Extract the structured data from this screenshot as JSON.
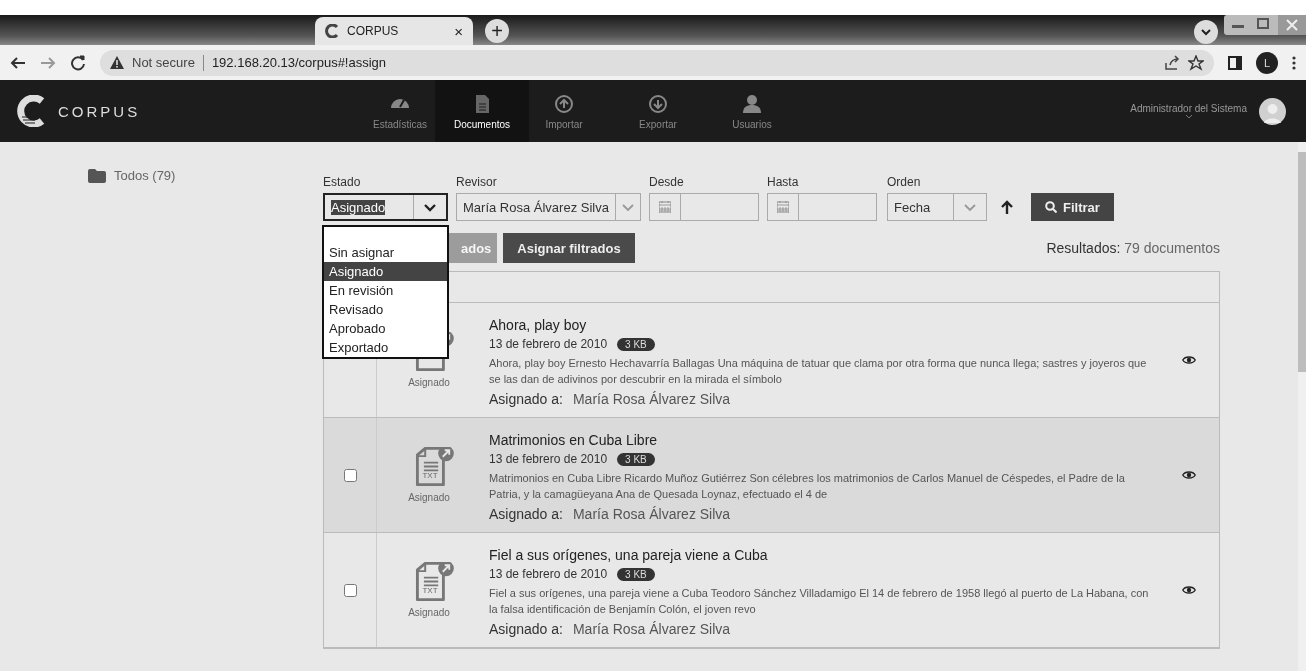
{
  "browser": {
    "tab_title": "CORPUS",
    "tab_close": "×",
    "new_tab": "+",
    "security": "Not secure",
    "url": "192.168.20.13/corpus#!assign",
    "profile": "L"
  },
  "navbar": {
    "logo": "CORPUS",
    "items": [
      {
        "label": "Estadísticas",
        "selected": false
      },
      {
        "label": "Documentos",
        "selected": true
      },
      {
        "label": "Importar",
        "selected": false
      },
      {
        "label": "Exportar",
        "selected": false
      },
      {
        "label": "Usuarios",
        "selected": false
      }
    ],
    "user": "Administrador del Sistema"
  },
  "sidebar": {
    "folders": [
      {
        "label": "Todos (79)"
      }
    ]
  },
  "filters": {
    "estado": {
      "label": "Estado",
      "value": "Asignado",
      "options": [
        {
          "label": "Sin asignar",
          "selected": false
        },
        {
          "label": "Asignado",
          "selected": true
        },
        {
          "label": "En revisión",
          "selected": false
        },
        {
          "label": "Revisado",
          "selected": false
        },
        {
          "label": "Aprobado",
          "selected": false
        },
        {
          "label": "Exportado",
          "selected": false
        }
      ]
    },
    "revisor": {
      "label": "Revisor",
      "value": "María Rosa Álvarez Silva"
    },
    "desde": {
      "label": "Desde"
    },
    "hasta": {
      "label": "Hasta"
    },
    "orden": {
      "label": "Orden",
      "value": "Fecha"
    },
    "filter_button": "Filtrar"
  },
  "actions": [
    {
      "label": "ados",
      "disabled": true
    },
    {
      "label": "Asignar filtrados",
      "disabled": false
    }
  ],
  "results": {
    "label": "Resultados:",
    "count": "79 documentos"
  },
  "documents": [
    {
      "title": "Ahora, play boy",
      "date": "13 de febrero de 2010",
      "size": "3 KB",
      "excerpt": "Ahora, play boy Ernesto Hechavarría Ballagas Una máquina de tatuar que clama por otra forma que nunca llega; sastres y joyeros que se las dan de adivinos por descubrir en la mirada el símbolo",
      "status": "Asignado",
      "assigned_label": "Asignado a:",
      "assignee": "María Rosa Álvarez Silva",
      "highlighted": false
    },
    {
      "title": "Matrimonios en Cuba Libre",
      "file_type": "TXT",
      "date": "13 de febrero de 2010",
      "size": "3 KB",
      "excerpt": "Matrimonios en Cuba Libre Ricardo Muñoz Gutiérrez Son célebres los matrimonios de Carlos Manuel de Céspedes, el Padre de la Patria, y la camagüeyana Ana de Quesada Loynaz, efectuado el 4 de",
      "status": "Asignado",
      "assigned_label": "Asignado a:",
      "assignee": "María Rosa Álvarez Silva",
      "highlighted": true,
      "checked": false
    },
    {
      "title": "Fiel a sus orígenes, una pareja viene a Cuba",
      "file_type": "TXT",
      "date": "13 de febrero de 2010",
      "size": "3 KB",
      "excerpt": "Fiel a sus orígenes, una pareja viene a Cuba Teodoro Sánchez Villadamigo El 14 de febrero de 1958 llegó al puerto de La Habana, con la falsa identificación de Benjamín Colón, el joven revo",
      "status": "Asignado",
      "assigned_label": "Asignado a:",
      "assignee": "María Rosa Álvarez Silva",
      "highlighted": false,
      "checked": false
    }
  ]
}
